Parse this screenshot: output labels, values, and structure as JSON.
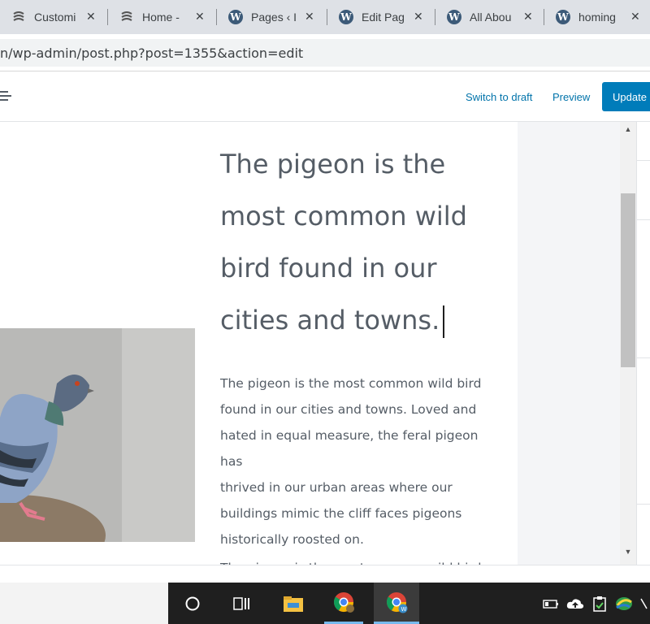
{
  "browser": {
    "tabs": [
      {
        "title": "Customi",
        "icon": "customizer-icon"
      },
      {
        "title": "Home -",
        "icon": "customizer-icon"
      },
      {
        "title": "Pages ‹ I",
        "icon": "wordpress-icon"
      },
      {
        "title": "Edit Pag",
        "icon": "wordpress-icon"
      },
      {
        "title": "All Abou",
        "icon": "wordpress-icon"
      },
      {
        "title": "homing",
        "icon": "wordpress-icon"
      }
    ],
    "close_glyph": "✕",
    "url": "n/wp-admin/post.php?post=1355&action=edit"
  },
  "wp_header": {
    "switch_to_draft": "Switch to draft",
    "preview": "Preview",
    "update": "Update"
  },
  "content": {
    "heading_lines": [
      "The pigeon is the",
      "most common wild",
      "bird found in our",
      "cities and towns."
    ],
    "paragraph_lines": [
      "The pigeon is the most common wild bird",
      "found in our cities and towns. Loved and",
      "hated in equal measure, the feral pigeon has",
      "thrived in our urban areas where our",
      "buildings mimic the cliff faces pigeons",
      "historically roosted on."
    ],
    "paragraph2_line": "The pigeon is the most common wild bird",
    "image_subject": "pigeon-photo"
  },
  "colors": {
    "accent": "#007cba",
    "link": "#0073aa",
    "text": "#555d66"
  }
}
